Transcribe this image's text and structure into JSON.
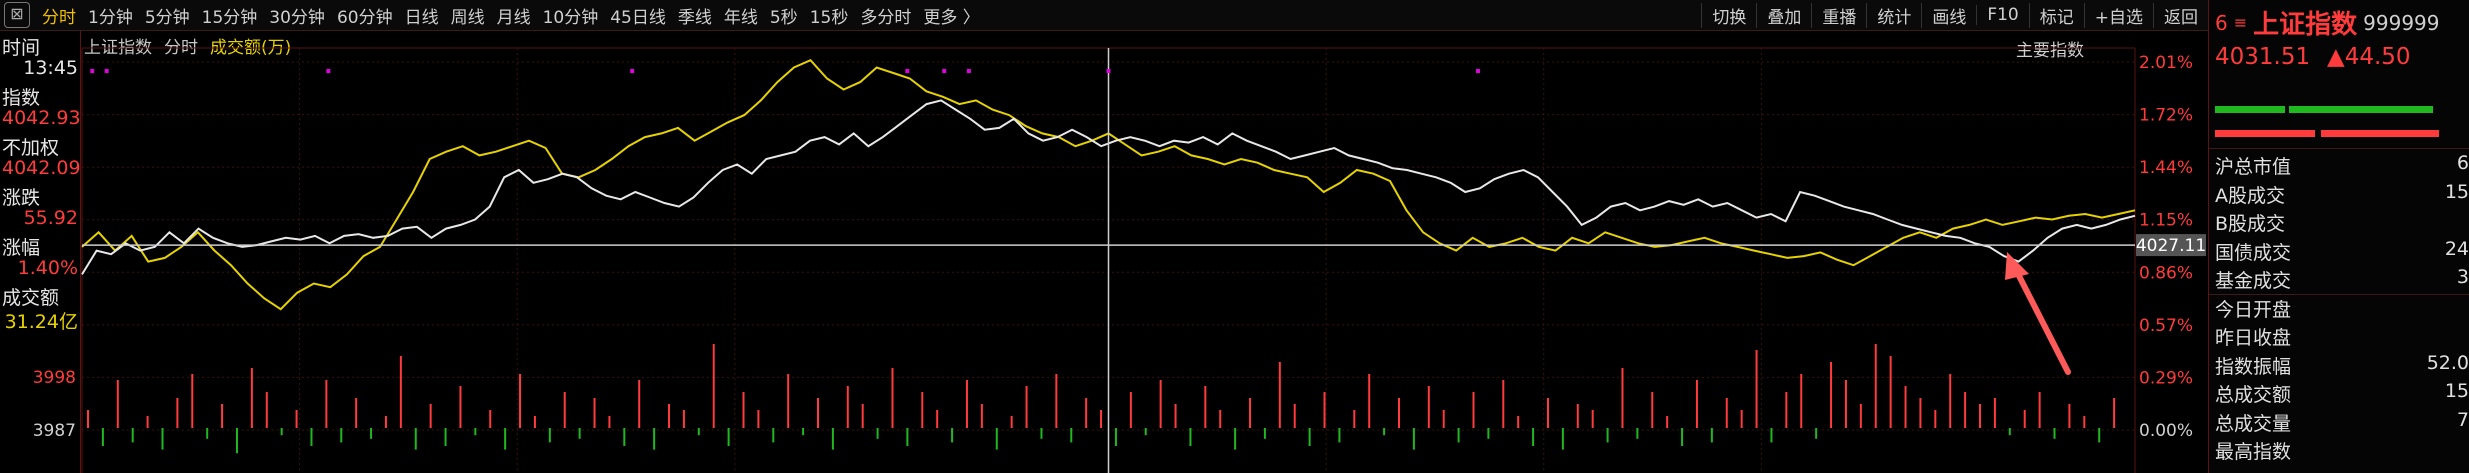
{
  "toolbar": {
    "close_glyph": "⊠",
    "items": [
      "分时",
      "1分钟",
      "5分钟",
      "15分钟",
      "30分钟",
      "60分钟",
      "日线",
      "周线",
      "月线",
      "10分钟",
      "45日线",
      "季线",
      "年线",
      "5秒",
      "15秒",
      "多分时",
      "更多 〉"
    ],
    "right_items": [
      "切换",
      "叠加",
      "重播",
      "统计",
      "画线",
      "F10",
      "标记",
      "+自选",
      "返回"
    ]
  },
  "left_panel": {
    "time_label": "时间",
    "time_value": "13:45",
    "index_label": "指数",
    "index_value": "4042.93",
    "unweighted_label": "不加权",
    "unweighted_value": "4042.09",
    "change_label": "涨跌",
    "change_value": "55.92",
    "pct_label": "涨幅",
    "pct_value": "1.40%",
    "amount_label": "成交额",
    "amount_value": "31.24亿"
  },
  "chart_header": {
    "name": "上证指数",
    "mode": "分时",
    "metric": "成交额(万)",
    "indicator": "主要指数"
  },
  "right_panel": {
    "six": "6",
    "menu": "≡",
    "name": "上证指数",
    "code": "999999",
    "price": "4031.51",
    "change": "▲44.50",
    "items": [
      {
        "label": "沪总市值",
        "value": "6"
      },
      {
        "label": "A股成交",
        "value": "15"
      },
      {
        "label": "B股成交",
        "value": ""
      },
      {
        "label": "国债成交",
        "value": "24"
      },
      {
        "label": "基金成交",
        "value": "3"
      },
      {
        "label": "今日开盘",
        "value": ""
      },
      {
        "label": "昨日收盘",
        "value": ""
      },
      {
        "label": "指数振幅",
        "value": "52.0"
      },
      {
        "label": "总成交额",
        "value": "15"
      },
      {
        "label": "总成交量",
        "value": "7"
      },
      {
        "label": "最高指数",
        "value": ""
      }
    ]
  },
  "colors": {
    "up": "#ff3b3b",
    "down": "#1fb81f",
    "line_white": "#e8e8e8",
    "line_yellow": "#e6d200",
    "arrow": "#ff5a5a"
  },
  "chart_data": {
    "type": "line",
    "right_axis_labels": [
      "2.01%",
      "1.72%",
      "1.44%",
      "1.15%",
      "0.86%",
      "0.57%",
      "0.29%",
      "0.00%"
    ],
    "left_axis_labels": [
      "3998",
      "3987"
    ],
    "crosshair_price_label": "4027.11",
    "crosshair_pct": 1.01,
    "series": [
      {
        "name": "上证指数",
        "values": [
          0.85,
          0.98,
          0.96,
          1.02,
          0.98,
          1.0,
          1.08,
          1.02,
          1.1,
          1.05,
          1.02,
          1.0,
          1.01,
          1.03,
          1.05,
          1.04,
          1.06,
          1.02,
          1.06,
          1.07,
          1.05,
          1.06,
          1.1,
          1.11,
          1.05,
          1.1,
          1.12,
          1.15,
          1.22,
          1.38,
          1.42,
          1.35,
          1.37,
          1.4,
          1.38,
          1.32,
          1.28,
          1.26,
          1.3,
          1.27,
          1.24,
          1.22,
          1.27,
          1.35,
          1.42,
          1.45,
          1.4,
          1.48,
          1.5,
          1.52,
          1.58,
          1.6,
          1.56,
          1.62,
          1.55,
          1.6,
          1.66,
          1.72,
          1.78,
          1.8,
          1.75,
          1.7,
          1.64,
          1.65,
          1.7,
          1.62,
          1.58,
          1.6,
          1.64,
          1.6,
          1.55,
          1.58,
          1.6,
          1.58,
          1.55,
          1.58,
          1.57,
          1.6,
          1.56,
          1.62,
          1.58,
          1.55,
          1.52,
          1.48,
          1.5,
          1.52,
          1.54,
          1.5,
          1.48,
          1.46,
          1.43,
          1.42,
          1.4,
          1.38,
          1.35,
          1.3,
          1.32,
          1.37,
          1.4,
          1.42,
          1.38,
          1.3,
          1.22,
          1.12,
          1.16,
          1.22,
          1.24,
          1.2,
          1.22,
          1.25,
          1.23,
          1.26,
          1.22,
          1.24,
          1.2,
          1.16,
          1.18,
          1.14,
          1.3,
          1.28,
          1.25,
          1.22,
          1.2,
          1.18,
          1.15,
          1.12,
          1.1,
          1.08,
          1.06,
          1.05,
          1.02,
          1.0,
          0.95,
          0.92,
          0.98,
          1.05,
          1.1,
          1.12,
          1.1,
          1.12,
          1.15,
          1.17
        ]
      },
      {
        "name": "成交均价",
        "values": [
          1.0,
          1.08,
          0.98,
          1.06,
          0.92,
          0.94,
          1.0,
          1.08,
          0.98,
          0.9,
          0.8,
          0.72,
          0.66,
          0.75,
          0.8,
          0.78,
          0.85,
          0.95,
          1.0,
          1.15,
          1.3,
          1.48,
          1.52,
          1.55,
          1.5,
          1.52,
          1.55,
          1.58,
          1.54,
          1.4,
          1.38,
          1.42,
          1.48,
          1.55,
          1.6,
          1.62,
          1.65,
          1.58,
          1.63,
          1.68,
          1.72,
          1.8,
          1.9,
          1.98,
          2.02,
          1.92,
          1.86,
          1.9,
          1.98,
          1.95,
          1.92,
          1.85,
          1.82,
          1.78,
          1.8,
          1.75,
          1.72,
          1.66,
          1.62,
          1.6,
          1.55,
          1.58,
          1.62,
          1.56,
          1.5,
          1.52,
          1.55,
          1.5,
          1.48,
          1.45,
          1.48,
          1.46,
          1.42,
          1.4,
          1.38,
          1.3,
          1.35,
          1.42,
          1.4,
          1.36,
          1.2,
          1.08,
          1.02,
          0.98,
          1.05,
          1.0,
          1.02,
          1.05,
          1.0,
          0.98,
          1.05,
          1.02,
          1.08,
          1.05,
          1.02,
          1.0,
          1.01,
          1.03,
          1.05,
          1.02,
          1.0,
          0.98,
          0.96,
          0.94,
          0.95,
          0.97,
          0.93,
          0.9,
          0.95,
          1.0,
          1.05,
          1.08,
          1.05,
          1.1,
          1.12,
          1.15,
          1.12,
          1.14,
          1.16,
          1.15,
          1.17,
          1.18,
          1.16,
          1.18,
          1.2
        ]
      },
      {
        "name": "成交额(万)",
        "values": [
          0.3,
          -0.5,
          0.8,
          -0.4,
          0.2,
          -0.6,
          0.5,
          0.9,
          -0.3,
          0.4,
          -0.7,
          1.0,
          0.6,
          -0.2,
          0.3,
          -0.5,
          0.8,
          -0.4,
          0.5,
          -0.3,
          0.2,
          1.2,
          -0.6,
          0.4,
          -0.5,
          0.7,
          -0.2,
          0.3,
          -0.6,
          0.9,
          0.2,
          -0.4,
          0.6,
          -0.3,
          0.5,
          0.2,
          -0.5,
          0.8,
          -0.6,
          0.4,
          0.3,
          -0.2,
          1.4,
          -0.5,
          0.6,
          0.3,
          -0.4,
          0.9,
          -0.2,
          0.5,
          -0.6,
          0.7,
          0.4,
          -0.3,
          1.0,
          -0.5,
          0.6,
          0.3,
          -0.4,
          0.8,
          0.4,
          -0.6,
          0.2,
          0.7,
          -0.3,
          0.9,
          -0.4,
          0.5,
          0.3,
          -0.5,
          0.6,
          -0.2,
          0.8,
          0.4,
          -0.5,
          0.7,
          0.3,
          -0.6,
          0.5,
          -0.3,
          1.1,
          0.4,
          -0.5,
          0.6,
          -0.4,
          0.3,
          0.9,
          -0.2,
          0.5,
          -0.6,
          0.7,
          0.3,
          -0.4,
          0.6,
          -0.3,
          0.8,
          0.2,
          -0.5,
          0.5,
          -0.6,
          0.4,
          0.3,
          -0.4,
          1.0,
          -0.3,
          0.6,
          0.2,
          -0.5,
          0.8,
          -0.4,
          0.5,
          0.3,
          1.3,
          -0.4,
          0.6,
          0.9,
          -0.3,
          1.1,
          0.8,
          0.4,
          1.4,
          1.2,
          0.7,
          0.5,
          0.3,
          0.9,
          0.6,
          0.4,
          0.5,
          -0.2,
          0.3,
          0.6,
          -0.3,
          0.4,
          0.2,
          -0.4,
          0.5
        ]
      }
    ],
    "top_markers": [
      0.005,
      0.012,
      0.12,
      0.268,
      0.402,
      0.42,
      0.432,
      0.5,
      0.68
    ],
    "annotation": "arrow",
    "ylim": [
      0.0,
      2.01
    ]
  }
}
